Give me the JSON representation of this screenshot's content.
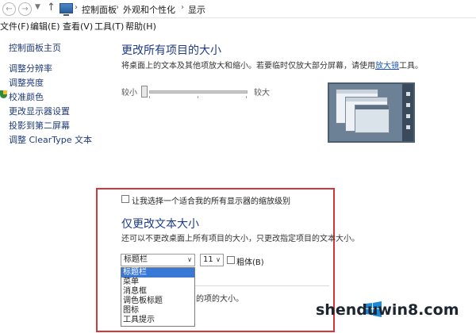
{
  "breadcrumb": {
    "items": [
      "控制面板",
      "外观和个性化",
      "显示"
    ]
  },
  "menubar": {
    "items": [
      "文件(F)",
      "编辑(E)",
      "查看(V)",
      "工具(T)",
      "帮助(H)"
    ]
  },
  "sidebar": {
    "items": [
      "控制面板主页",
      "调整分辨率",
      "调整亮度",
      "校准颜色",
      "更改显示器设置",
      "投影到第二屏幕",
      "调整 ClearType 文本"
    ]
  },
  "main": {
    "title": "更改所有项目的大小",
    "desc_prefix": "将桌面上的文本及其他项放大和缩小。若要临时仅放大部分屏幕，请使用",
    "desc_link": "放大镜",
    "desc_suffix": "工具。",
    "slider": {
      "min_label": "较小",
      "max_label": "较大",
      "level": 0
    }
  },
  "scaling_checkbox": {
    "label": "让我选择一个适合我的所有显示器的缩放级别",
    "checked": false
  },
  "text_size": {
    "title": "仅更改文本大小",
    "desc": "还可以不更改桌面上所有项目的大小，只更改指定项目的文本大小。",
    "item_select": {
      "value": "标题栏",
      "options": [
        "标题栏",
        "菜单",
        "消息框",
        "调色板标题",
        "图标",
        "工具提示"
      ]
    },
    "size_select": {
      "value": "11"
    },
    "bold": {
      "label": "粗体(B)",
      "checked": false
    },
    "partial_text": "的项的大小。"
  },
  "watermark": {
    "text": "shenduwin8.com"
  },
  "colors": {
    "highlight_box": "#d13838",
    "link": "#1f3b7a",
    "title": "#1e3a8a",
    "selection": "#3a78d6"
  }
}
